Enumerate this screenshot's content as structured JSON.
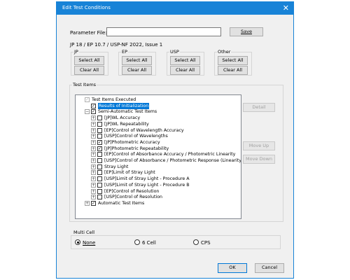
{
  "window": {
    "title": "Edit Test Conditions",
    "close_glyph": "✕"
  },
  "parameter_file": {
    "label": "Parameter File:",
    "value": "",
    "save_label": "Save"
  },
  "pharmacopoeia": "JP 18 / EP 10.7 / USP-NF 2022, Issue 1",
  "groups": [
    {
      "label": "JP",
      "select_all": "Select All",
      "clear_all": "Clear All"
    },
    {
      "label": "EP",
      "select_all": "Select All",
      "clear_all": "Clear All"
    },
    {
      "label": "USP",
      "select_all": "Select All",
      "clear_all": "Clear All"
    },
    {
      "label": "Other",
      "select_all": "Select All",
      "clear_all": "Clear All"
    }
  ],
  "test_items": {
    "label": "Test Items",
    "tree": [
      {
        "label": "Test Items Executed",
        "checked": true,
        "dim": true,
        "expander": ""
      },
      {
        "label": "Results of Initialization",
        "checked": true,
        "selected": true,
        "expander": ""
      },
      {
        "label": "Semi-Automatic Test Items",
        "checked": true,
        "expander": "−"
      },
      {
        "label": "[JP]WL Accuracy",
        "checked": false,
        "expander": "+"
      },
      {
        "label": "[JP]WL Repeatability",
        "checked": false,
        "expander": "+"
      },
      {
        "label": "[EP]Control of Wavelength Accuracy",
        "checked": false,
        "expander": "+"
      },
      {
        "label": "[USP]Control of Wavelengths",
        "checked": false,
        "expander": "+"
      },
      {
        "label": "[JP]Photometric Accuracy",
        "checked": true,
        "expander": "+"
      },
      {
        "label": "[JP]Photometric Repeatability",
        "checked": true,
        "expander": "+"
      },
      {
        "label": "[EP]Control of Absorbance Accuracy / Photometric Linearity",
        "checked": false,
        "expander": "+"
      },
      {
        "label": "[USP]Control of Absorbance / Photometric Response (Linearity)",
        "checked": false,
        "expander": "+"
      },
      {
        "label": "Stray Light",
        "checked": false,
        "expander": "+"
      },
      {
        "label": "[EP]Limit of Stray Light",
        "checked": false,
        "expander": "+"
      },
      {
        "label": "[USP]Limit of Stray Light - Procedure A",
        "checked": false,
        "expander": "+"
      },
      {
        "label": "[USP]Limit of Stray Light - Procedure B",
        "checked": false,
        "expander": "+"
      },
      {
        "label": "[EP]Control of Resolution",
        "checked": false,
        "expander": "+"
      },
      {
        "label": "[USP]Control of Resolution",
        "checked": false,
        "expander": "+"
      },
      {
        "label": "Automatic Test Items",
        "checked": true,
        "expander": "+"
      }
    ],
    "detail_label": "Detail",
    "move_up_label": "Move Up",
    "move_down_label": "Move Down"
  },
  "multi_cell": {
    "label": "Multi Cell",
    "options": [
      {
        "label": "None",
        "selected": true
      },
      {
        "label": "6 Cell",
        "selected": false
      },
      {
        "label": "CPS",
        "selected": false
      }
    ]
  },
  "footer": {
    "ok_label": "OK",
    "cancel_label": "Cancel"
  },
  "colors": {
    "title_bar": "#1883d7",
    "selection": "#0078d7",
    "dialog_bg": "#f0f0f0"
  }
}
